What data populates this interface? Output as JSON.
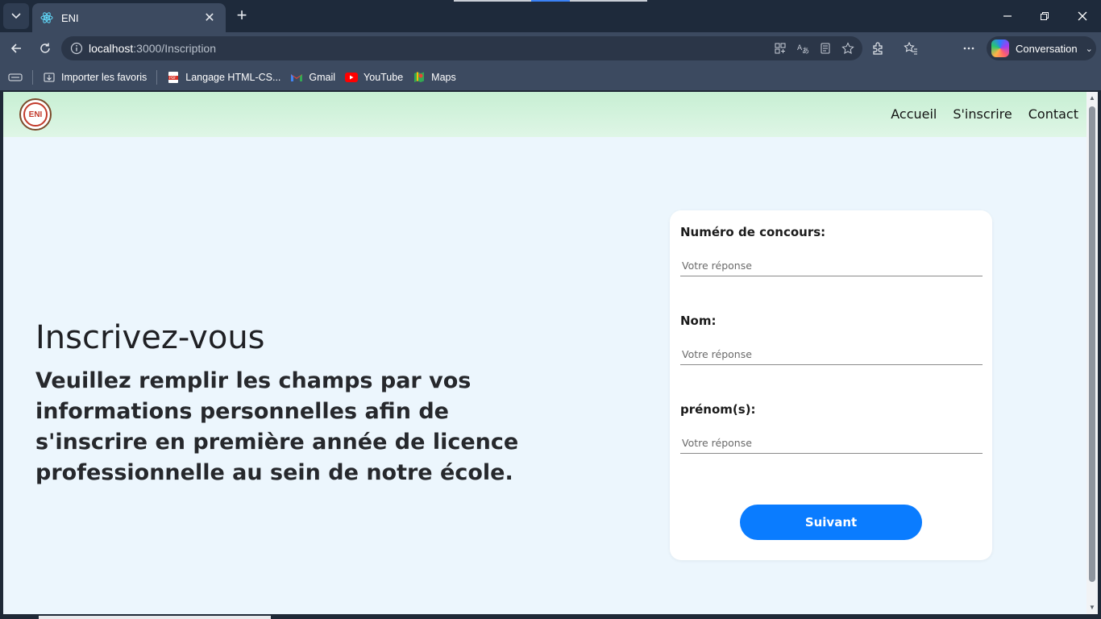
{
  "browser": {
    "tab_title": "ENI",
    "address_host": "localhost",
    "address_path": ":3000/Inscription",
    "copilot_label": "Conversation",
    "bookmarks": [
      {
        "label": "Importer les favoris",
        "icon": "import-favorites-icon"
      },
      {
        "label": "Langage HTML-CS...",
        "icon": "pdf-icon"
      },
      {
        "label": "Gmail",
        "icon": "gmail-icon"
      },
      {
        "label": "YouTube",
        "icon": "youtube-icon"
      },
      {
        "label": "Maps",
        "icon": "maps-icon"
      }
    ]
  },
  "site": {
    "logo_text": "ENI",
    "nav": [
      "Accueil",
      "S'inscrire",
      "Contact"
    ]
  },
  "hero": {
    "title": "Inscrivez-vous",
    "text": "Veuillez remplir les champs par vos informations personnelles afin de s'inscrire en première année de licence professionnelle au sein de notre école."
  },
  "form": {
    "fields": [
      {
        "label": "Numéro de concours:",
        "placeholder": "Votre réponse"
      },
      {
        "label": "Nom:",
        "placeholder": "Votre réponse"
      },
      {
        "label": "prénom(s):",
        "placeholder": "Votre réponse"
      }
    ],
    "submit_label": "Suivant"
  },
  "colors": {
    "accent": "#0a7cff",
    "page_background": "#ecf6fd",
    "header_background": "#c7efd3",
    "browser_chrome": "#3c4a60"
  }
}
